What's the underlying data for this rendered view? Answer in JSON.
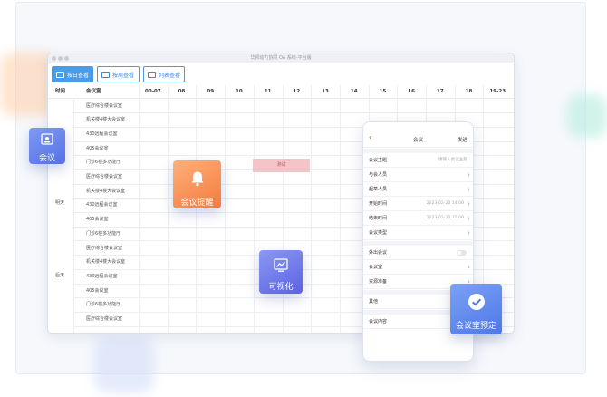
{
  "window": {
    "title": "华邦动力协同 OA 系统-平台版"
  },
  "toolbar": {
    "buttons": [
      {
        "label": "按日查看",
        "active": true
      },
      {
        "label": "按周查看",
        "active": false
      },
      {
        "label": "列表查看",
        "active": false
      }
    ]
  },
  "grid": {
    "col_time": "时间",
    "col_room": "会议室",
    "hours": [
      "00-07",
      "08",
      "09",
      "10",
      "11",
      "12",
      "13",
      "14",
      "15",
      "16",
      "17",
      "18",
      "19-23"
    ],
    "rooms": [
      "医疗综合楼会议室",
      "机关楼4楼大会议室",
      "430远程会议室",
      "405会议室",
      "门诊6楼多功能厅",
      "医疗综合楼会议室",
      "机关楼4楼大会议室",
      "430远程会议室",
      "405会议室",
      "门诊6楼多功能厅",
      "医疗综合楼会议室",
      "机关楼4楼大会议室",
      "430远程会议室",
      "405会议室",
      "门诊6楼多功能厅",
      "医疗综合楼会议室"
    ],
    "groups": [
      {
        "label": "明天"
      },
      {
        "label": "后天"
      }
    ],
    "booking_label": "测试"
  },
  "phone": {
    "title": "会议",
    "send": "发送",
    "rows": [
      {
        "label": "会议主题",
        "value": "请输入会议主题",
        "chevron": false
      },
      {
        "label": "与会人员",
        "value": "",
        "chevron": true
      },
      {
        "label": "起草人员",
        "value": "",
        "chevron": true
      },
      {
        "label": "开始时间",
        "value": "2023-02-20 14:00",
        "chevron": true
      },
      {
        "label": "结束时间",
        "value": "2023-02-20 15:00",
        "chevron": true
      },
      {
        "label": "会议类型",
        "value": "",
        "chevron": true
      },
      {
        "label": "外出会议",
        "value": "",
        "toggle": true
      },
      {
        "label": "会议室",
        "value": "",
        "chevron": true
      },
      {
        "label": "资源准备",
        "value": "",
        "chevron": true
      },
      {
        "label": "其他",
        "value": "",
        "chevron": false
      },
      {
        "label": "会议内容",
        "value": "",
        "chevron": false
      }
    ]
  },
  "features": {
    "meeting": "会议",
    "remind": "会议提醒",
    "visual": "可视化",
    "booking": "会议室预定"
  },
  "colors": {
    "accent": "#4a9be8",
    "booking": "#f5c4c8",
    "orange": "#f27b3e",
    "indigo": "#5b63e2"
  },
  "icons": [
    "meeting-icon",
    "bell-icon",
    "chart-icon",
    "check-icon"
  ]
}
